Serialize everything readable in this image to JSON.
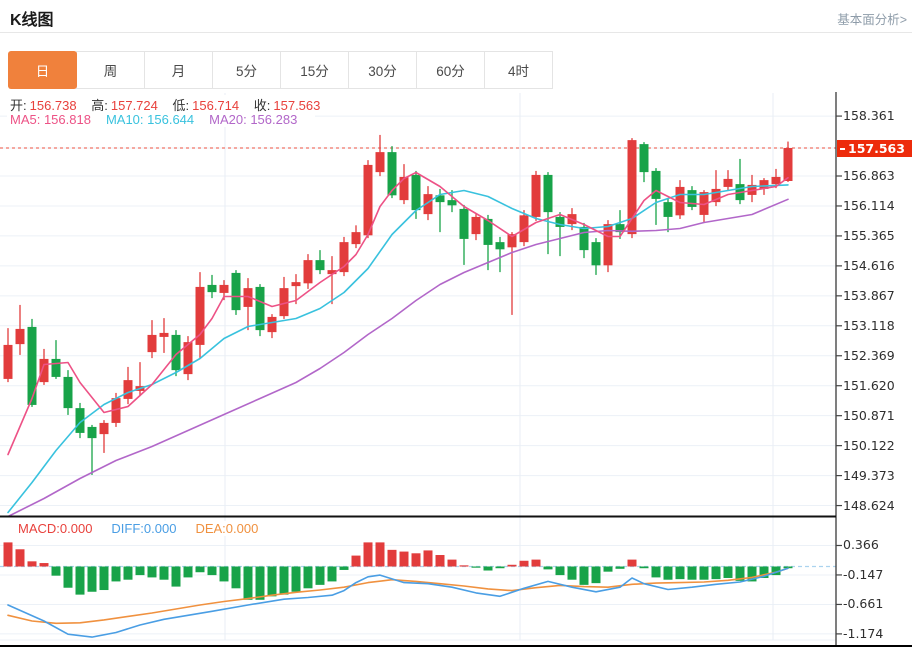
{
  "header": {
    "title": "K线图",
    "link_label": "基本面分析>"
  },
  "tabs": {
    "items": [
      "日",
      "周",
      "月",
      "5分",
      "15分",
      "30分",
      "60分",
      "4时"
    ],
    "active": "日"
  },
  "ohlc_legend": {
    "open_label": "开:",
    "open_value": "156.738",
    "high_label": "高:",
    "high_value": "157.724",
    "low_label": "低:",
    "low_value": "156.714",
    "close_label": "收:",
    "close_value": "157.563"
  },
  "ma_legend": {
    "ma5": "MA5: 156.818",
    "ma10": "MA10: 156.644",
    "ma20": "MA20: 156.283"
  },
  "macd_legend": {
    "macd": "MACD:0.000",
    "diff": "DIFF:0.000",
    "dea": "DEA:0.000"
  },
  "price_axis": {
    "tick_labels": [
      "158.361",
      "156.863",
      "156.114",
      "155.365",
      "154.616",
      "153.867",
      "153.118",
      "152.369",
      "151.620",
      "150.871",
      "150.122",
      "149.373",
      "148.624"
    ],
    "current_tag": "157.563"
  },
  "macd_axis": {
    "tick_labels": [
      "0.366",
      "-0.147",
      "-0.661",
      "-1.174"
    ]
  },
  "colors": {
    "up_red": "#E23C3C",
    "down_green": "#18A349",
    "ma5_pink": "#ED5286",
    "ma10_cyan": "#39C2DE",
    "ma20_purple": "#B267C9",
    "diff_blue": "#4A9EE4",
    "dea_orange": "#F0913F",
    "tab_active_orange": "#F0813C",
    "tag_red": "#ED2B0B",
    "value_red": "#E8413C",
    "dotted_red": "#F28C80",
    "zero_dash_blue": "#ABD3EF"
  },
  "chart_data": {
    "type": "candlestick",
    "title": "K线图",
    "interval": "日",
    "legend_position": "top-left",
    "grid": true,
    "y_axis": {
      "ticks": [
        158.361,
        157.563,
        156.863,
        156.114,
        155.365,
        154.616,
        153.867,
        153.118,
        152.369,
        151.62,
        150.871,
        150.122,
        149.373,
        148.624
      ],
      "current_price": 157.563
    },
    "last_bar": {
      "open": 156.738,
      "high": 157.724,
      "low": 156.714,
      "close": 157.563
    },
    "ma_last": {
      "ma5": 156.818,
      "ma10": 156.644,
      "ma20": 156.283
    },
    "candles": [
      [
        151.79,
        153.06,
        151.71,
        152.64
      ],
      [
        152.66,
        153.64,
        152.39,
        153.04
      ],
      [
        153.09,
        153.29,
        151.09,
        151.14
      ],
      [
        151.71,
        152.54,
        151.64,
        152.29
      ],
      [
        152.29,
        152.76,
        151.79,
        151.84
      ],
      [
        151.84,
        152.01,
        150.89,
        151.06
      ],
      [
        151.06,
        151.19,
        150.31,
        150.44
      ],
      [
        150.59,
        150.64,
        149.39,
        150.31
      ],
      [
        150.41,
        150.76,
        149.94,
        150.69
      ],
      [
        150.69,
        151.44,
        150.59,
        151.31
      ],
      [
        151.29,
        152.09,
        151.16,
        151.76
      ],
      [
        151.49,
        152.21,
        151.36,
        151.61
      ],
      [
        152.46,
        153.26,
        152.31,
        152.89
      ],
      [
        152.84,
        153.31,
        152.44,
        152.94
      ],
      [
        152.89,
        153.01,
        151.86,
        152.01
      ],
      [
        151.91,
        152.86,
        151.76,
        152.71
      ],
      [
        152.64,
        154.46,
        152.31,
        154.09
      ],
      [
        154.14,
        154.39,
        153.81,
        153.96
      ],
      [
        153.94,
        154.26,
        153.76,
        154.14
      ],
      [
        154.44,
        154.51,
        153.39,
        153.51
      ],
      [
        153.59,
        154.31,
        153.01,
        154.06
      ],
      [
        154.09,
        154.16,
        152.86,
        153.01
      ],
      [
        152.96,
        153.41,
        152.81,
        153.34
      ],
      [
        153.36,
        154.34,
        153.29,
        154.06
      ],
      [
        154.11,
        154.41,
        153.66,
        154.21
      ],
      [
        154.18,
        154.91,
        154.04,
        154.76
      ],
      [
        154.76,
        155.01,
        154.41,
        154.51
      ],
      [
        154.41,
        154.86,
        153.66,
        154.51
      ],
      [
        154.46,
        155.34,
        154.36,
        155.21
      ],
      [
        155.16,
        155.63,
        155.06,
        155.46
      ],
      [
        155.38,
        157.26,
        155.31,
        157.14
      ],
      [
        156.96,
        157.89,
        156.86,
        157.46
      ],
      [
        157.46,
        157.61,
        156.31,
        156.38
      ],
      [
        156.26,
        157.16,
        156.16,
        156.84
      ],
      [
        156.89,
        156.99,
        155.79,
        156.01
      ],
      [
        155.91,
        156.61,
        155.76,
        156.41
      ],
      [
        156.38,
        156.54,
        155.46,
        156.21
      ],
      [
        156.26,
        156.51,
        155.96,
        156.13
      ],
      [
        156.04,
        156.14,
        154.64,
        155.29
      ],
      [
        155.41,
        155.91,
        155.26,
        155.84
      ],
      [
        155.79,
        155.89,
        154.51,
        155.14
      ],
      [
        155.21,
        155.34,
        154.46,
        155.03
      ],
      [
        155.08,
        155.46,
        153.39,
        155.41
      ],
      [
        155.21,
        156.01,
        155.11,
        155.88
      ],
      [
        155.84,
        156.99,
        155.74,
        156.89
      ],
      [
        156.89,
        156.96,
        154.91,
        155.96
      ],
      [
        155.84,
        155.96,
        154.86,
        155.59
      ],
      [
        155.66,
        156.06,
        155.51,
        155.91
      ],
      [
        155.59,
        155.69,
        154.81,
        155.01
      ],
      [
        155.21,
        155.31,
        154.39,
        154.63
      ],
      [
        154.63,
        155.76,
        154.46,
        155.66
      ],
      [
        155.66,
        156.01,
        155.29,
        155.46
      ],
      [
        155.41,
        157.81,
        155.31,
        157.76
      ],
      [
        157.66,
        157.71,
        156.71,
        156.96
      ],
      [
        156.99,
        157.06,
        155.64,
        156.29
      ],
      [
        156.21,
        156.31,
        155.46,
        155.84
      ],
      [
        155.88,
        156.76,
        155.79,
        156.59
      ],
      [
        156.51,
        156.61,
        156.01,
        156.09
      ],
      [
        155.89,
        156.51,
        155.69,
        156.46
      ],
      [
        156.21,
        157.01,
        156.11,
        156.54
      ],
      [
        156.59,
        157.01,
        156.49,
        156.79
      ],
      [
        156.66,
        157.29,
        156.16,
        156.26
      ],
      [
        156.39,
        156.89,
        156.21,
        156.64
      ],
      [
        156.54,
        156.81,
        156.39,
        156.76
      ],
      [
        156.66,
        157.04,
        156.56,
        156.84
      ],
      [
        156.738,
        157.724,
        156.714,
        157.563
      ]
    ],
    "ma5_points": [
      [
        0,
        149.9
      ],
      [
        2,
        151.3
      ],
      [
        3,
        152.15
      ],
      [
        5,
        152.2
      ],
      [
        6,
        151.7
      ],
      [
        8,
        150.95
      ],
      [
        10,
        151.1
      ],
      [
        12,
        151.65
      ],
      [
        14,
        152.4
      ],
      [
        16,
        152.9
      ],
      [
        17,
        153.3
      ],
      [
        18,
        153.85
      ],
      [
        20,
        153.85
      ],
      [
        22,
        153.6
      ],
      [
        24,
        153.75
      ],
      [
        26,
        154.2
      ],
      [
        28,
        154.6
      ],
      [
        29,
        154.9
      ],
      [
        30,
        155.4
      ],
      [
        31,
        156.1
      ],
      [
        32,
        156.5
      ],
      [
        33,
        156.8
      ],
      [
        34,
        156.95
      ],
      [
        36,
        156.6
      ],
      [
        38,
        156.1
      ],
      [
        40,
        155.75
      ],
      [
        42,
        155.35
      ],
      [
        44,
        155.7
      ],
      [
        46,
        155.9
      ],
      [
        48,
        155.65
      ],
      [
        50,
        155.35
      ],
      [
        51,
        155.35
      ],
      [
        52,
        155.8
      ],
      [
        53,
        156.25
      ],
      [
        54,
        156.5
      ],
      [
        56,
        156.2
      ],
      [
        58,
        156.15
      ],
      [
        60,
        156.4
      ],
      [
        62,
        156.5
      ],
      [
        64,
        156.6
      ],
      [
        65,
        156.82
      ]
    ],
    "ma10_points": [
      [
        0,
        148.45
      ],
      [
        2,
        149.2
      ],
      [
        4,
        150.0
      ],
      [
        6,
        150.7
      ],
      [
        8,
        151.15
      ],
      [
        10,
        151.45
      ],
      [
        12,
        151.65
      ],
      [
        14,
        151.95
      ],
      [
        16,
        152.3
      ],
      [
        18,
        152.8
      ],
      [
        20,
        153.1
      ],
      [
        22,
        153.2
      ],
      [
        24,
        153.3
      ],
      [
        26,
        153.55
      ],
      [
        28,
        153.95
      ],
      [
        30,
        154.55
      ],
      [
        32,
        155.4
      ],
      [
        34,
        156.0
      ],
      [
        36,
        156.4
      ],
      [
        38,
        156.5
      ],
      [
        40,
        156.35
      ],
      [
        42,
        156.05
      ],
      [
        44,
        155.8
      ],
      [
        46,
        155.65
      ],
      [
        48,
        155.55
      ],
      [
        50,
        155.6
      ],
      [
        52,
        155.8
      ],
      [
        54,
        156.2
      ],
      [
        56,
        156.4
      ],
      [
        58,
        156.4
      ],
      [
        60,
        156.5
      ],
      [
        62,
        156.6
      ],
      [
        65,
        156.64
      ]
    ],
    "ma20_points": [
      [
        0,
        148.35
      ],
      [
        3,
        148.8
      ],
      [
        6,
        149.3
      ],
      [
        9,
        149.75
      ],
      [
        12,
        150.1
      ],
      [
        15,
        150.5
      ],
      [
        18,
        150.9
      ],
      [
        21,
        151.3
      ],
      [
        24,
        151.7
      ],
      [
        26,
        152.05
      ],
      [
        28,
        152.45
      ],
      [
        30,
        152.9
      ],
      [
        32,
        153.3
      ],
      [
        34,
        153.75
      ],
      [
        36,
        154.15
      ],
      [
        38,
        154.45
      ],
      [
        40,
        154.7
      ],
      [
        42,
        154.95
      ],
      [
        44,
        155.15
      ],
      [
        46,
        155.3
      ],
      [
        48,
        155.45
      ],
      [
        50,
        155.5
      ],
      [
        52,
        155.48
      ],
      [
        54,
        155.5
      ],
      [
        56,
        155.55
      ],
      [
        58,
        155.7
      ],
      [
        60,
        155.8
      ],
      [
        62,
        155.9
      ],
      [
        65,
        156.28
      ]
    ],
    "macd": {
      "last": {
        "macd": 0.0,
        "diff": 0.0,
        "dea": 0.0
      },
      "y_ticks": [
        0.366,
        -0.147,
        -0.661,
        -1.174
      ],
      "histogram": [
        0.42,
        0.3,
        0.09,
        0.06,
        -0.16,
        -0.37,
        -0.49,
        -0.44,
        -0.41,
        -0.26,
        -0.23,
        -0.15,
        -0.19,
        -0.23,
        -0.35,
        -0.19,
        -0.1,
        -0.15,
        -0.26,
        -0.38,
        -0.58,
        -0.58,
        -0.52,
        -0.49,
        -0.44,
        -0.38,
        -0.32,
        -0.26,
        -0.06,
        0.19,
        0.42,
        0.42,
        0.29,
        0.26,
        0.23,
        0.28,
        0.2,
        0.12,
        0.02,
        -0.02,
        -0.07,
        -0.03,
        0.03,
        0.1,
        0.12,
        -0.05,
        -0.15,
        -0.23,
        -0.32,
        -0.29,
        -0.09,
        -0.04,
        0.12,
        -0.03,
        -0.19,
        -0.23,
        -0.22,
        -0.23,
        -0.23,
        -0.22,
        -0.2,
        -0.25,
        -0.26,
        -0.2,
        -0.15,
        -0.03
      ],
      "diff_points": [
        [
          0,
          -0.67
        ],
        [
          3,
          -0.95
        ],
        [
          5,
          -1.18
        ],
        [
          7,
          -1.23
        ],
        [
          9,
          -1.15
        ],
        [
          11,
          -1.02
        ],
        [
          13,
          -0.92
        ],
        [
          15,
          -0.85
        ],
        [
          17,
          -0.78
        ],
        [
          20,
          -0.67
        ],
        [
          23,
          -0.57
        ],
        [
          25,
          -0.54
        ],
        [
          27,
          -0.5
        ],
        [
          28,
          -0.42
        ],
        [
          29,
          -0.28
        ],
        [
          30,
          -0.18
        ],
        [
          31,
          -0.15
        ],
        [
          33,
          -0.28
        ],
        [
          35,
          -0.3
        ],
        [
          37,
          -0.36
        ],
        [
          39,
          -0.46
        ],
        [
          41,
          -0.52
        ],
        [
          43,
          -0.38
        ],
        [
          45,
          -0.26
        ],
        [
          47,
          -0.36
        ],
        [
          49,
          -0.44
        ],
        [
          51,
          -0.36
        ],
        [
          52,
          -0.2
        ],
        [
          53,
          -0.3
        ],
        [
          55,
          -0.4
        ],
        [
          57,
          -0.36
        ],
        [
          59,
          -0.31
        ],
        [
          61,
          -0.27
        ],
        [
          63,
          -0.17
        ],
        [
          65,
          -0.03
        ]
      ],
      "dea_points": [
        [
          0,
          -0.85
        ],
        [
          2,
          -0.95
        ],
        [
          4,
          -0.99
        ],
        [
          6,
          -0.98
        ],
        [
          8,
          -0.93
        ],
        [
          10,
          -0.87
        ],
        [
          12,
          -0.81
        ],
        [
          14,
          -0.74
        ],
        [
          16,
          -0.67
        ],
        [
          18,
          -0.61
        ],
        [
          20,
          -0.56
        ],
        [
          22,
          -0.5
        ],
        [
          24,
          -0.45
        ],
        [
          26,
          -0.41
        ],
        [
          28,
          -0.36
        ],
        [
          30,
          -0.28
        ],
        [
          32,
          -0.23
        ],
        [
          34,
          -0.26
        ],
        [
          36,
          -0.3
        ],
        [
          38,
          -0.34
        ],
        [
          40,
          -0.39
        ],
        [
          42,
          -0.42
        ],
        [
          44,
          -0.37
        ],
        [
          46,
          -0.33
        ],
        [
          48,
          -0.35
        ],
        [
          50,
          -0.36
        ],
        [
          52,
          -0.31
        ],
        [
          54,
          -0.29
        ],
        [
          56,
          -0.28
        ],
        [
          58,
          -0.27
        ],
        [
          60,
          -0.24
        ],
        [
          62,
          -0.19
        ],
        [
          64,
          -0.1
        ],
        [
          65,
          -0.03
        ]
      ]
    }
  }
}
